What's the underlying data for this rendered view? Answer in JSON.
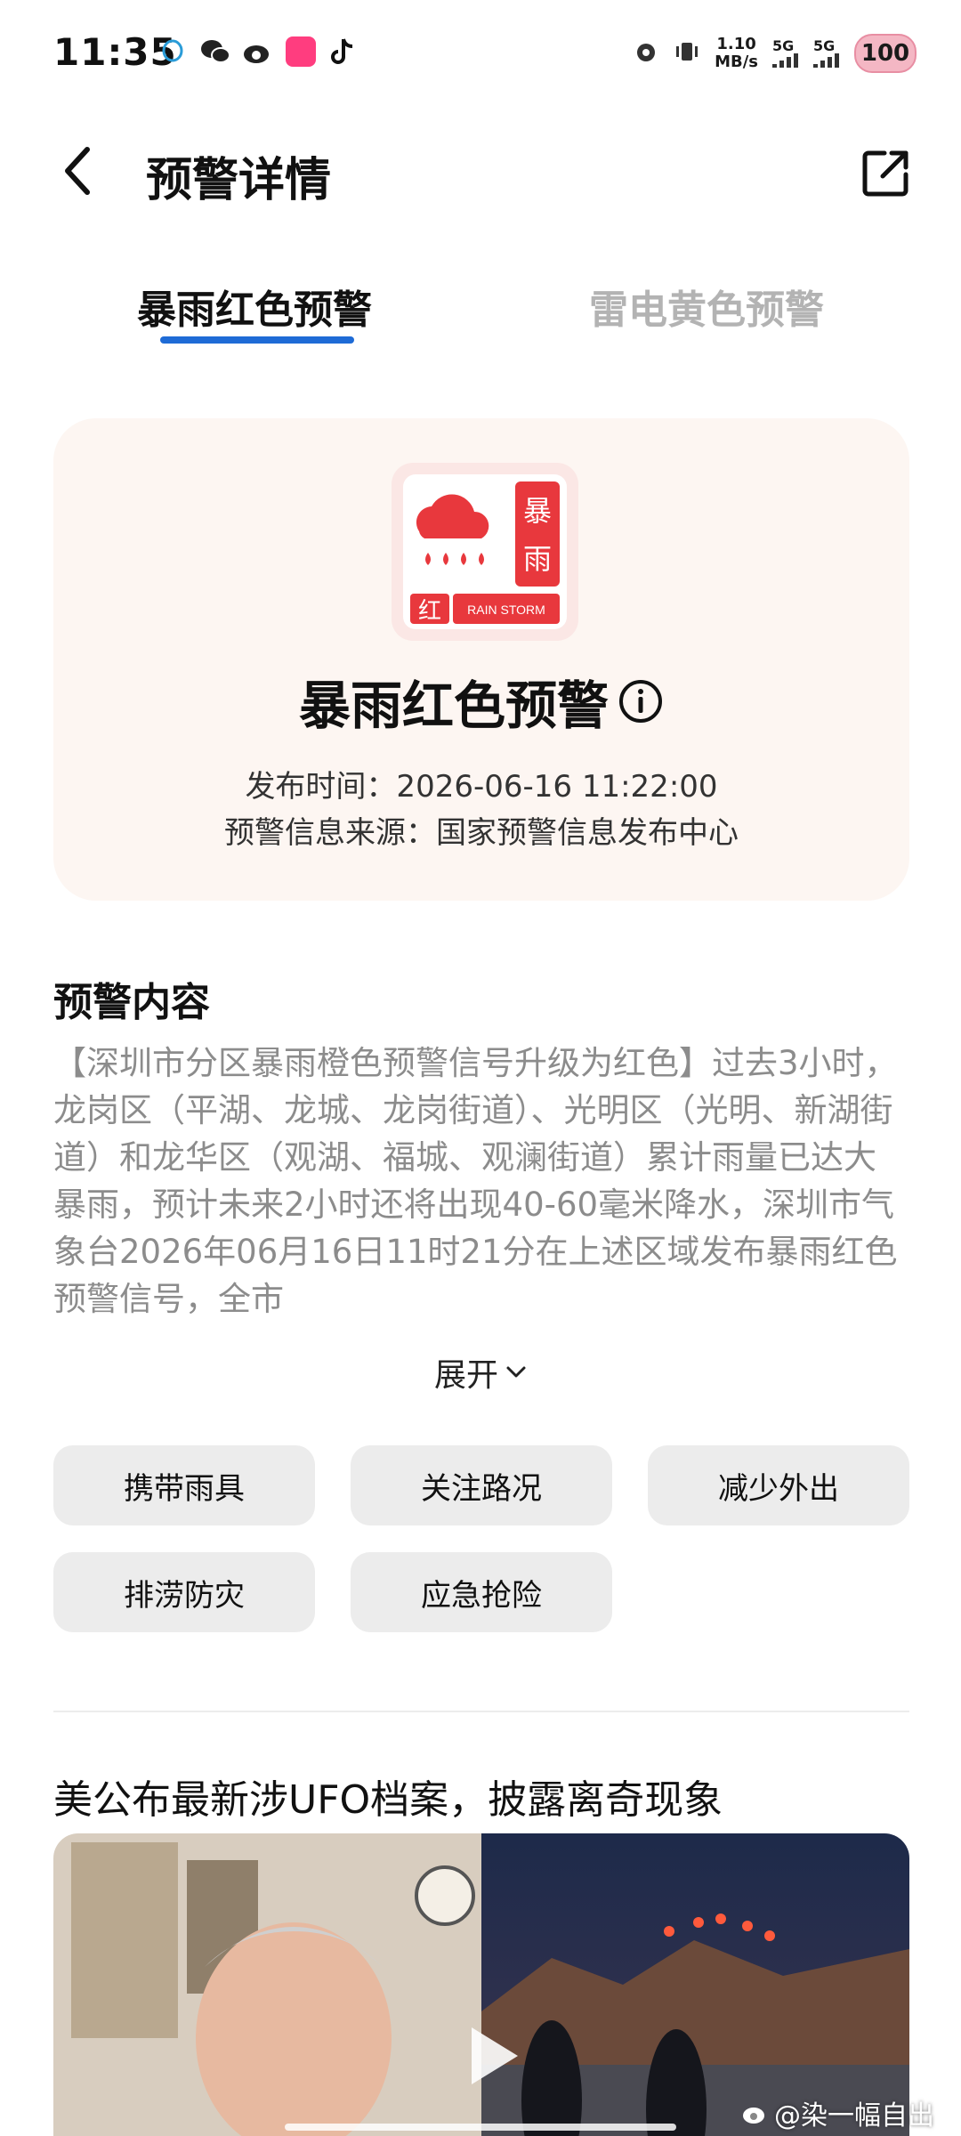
{
  "status_bar": {
    "time": "11:35",
    "app_icons": [
      "qq-icon",
      "wechat-icon",
      "weibo-icon",
      "lofter-icon",
      "tiktok-icon"
    ],
    "alarm_icon": "alarm-icon",
    "vibrate_icon": "vibrate-icon",
    "speed_value": "1.10",
    "speed_unit": "MB/s",
    "sim1_label": "5G",
    "sim2_label": "5G",
    "battery": "100"
  },
  "app_bar": {
    "title": "预警详情",
    "back_icon": "chevron-left-icon",
    "share_icon": "external-link-icon"
  },
  "tabs": [
    {
      "label": "暴雨红色预警",
      "active": true
    },
    {
      "label": "雷电黄色预警",
      "active": false
    }
  ],
  "alert": {
    "badge_char_top": "暴",
    "badge_char_bottom": "雨",
    "badge_level_char": "红",
    "badge_caption": "RAIN STORM",
    "title": "暴雨红色预警",
    "publish_time": "发布时间：2026-06-16 11:22:00",
    "source": "预警信息来源：国家预警信息发布中心",
    "colors": {
      "badge_red": "#e8383d",
      "card_bg": "#fdf6f2"
    }
  },
  "content": {
    "section_title": "预警内容",
    "text": "【深圳市分区暴雨橙色预警信号升级为红色】过去3小时，龙岗区（平湖、龙城、龙岗街道）、光明区（光明、新湖街道）和龙华区（观湖、福城、观澜街道）累计雨量已达大暴雨，预计未来2小时还将出现40-60毫米降水，深圳市气象台2026年06月16日11时21分在上述区域发布暴雨红色预警信号，全市",
    "expand_label": "展开"
  },
  "chips": [
    "携带雨具",
    "关注路况",
    "减少外出",
    "排涝防灾",
    "应急抢险"
  ],
  "news": {
    "title": "美公布最新涉UFO档案，披露离奇现象",
    "watermark": "@染一幅自出"
  },
  "accent_color": "#1e6bd6"
}
